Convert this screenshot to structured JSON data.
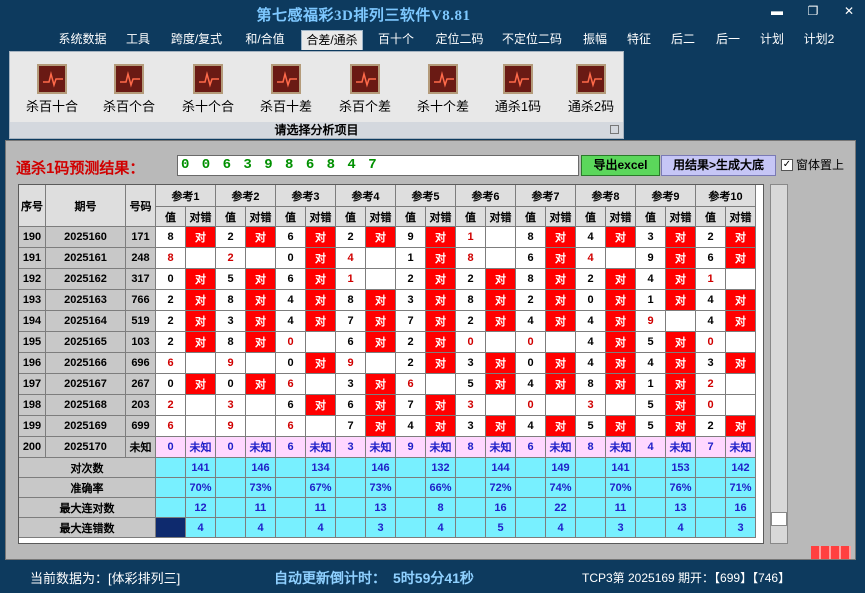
{
  "window": {
    "title": "第七感福彩3D排列三软件V8.81"
  },
  "menu": [
    "系统数据",
    "工具",
    "跨度/复式",
    "和/合值",
    "合差/通杀",
    "百十个",
    "定位二码",
    "不定位二码",
    "振幅",
    "特征",
    "后二",
    "后一",
    "计划",
    "计划2"
  ],
  "menu_active_index": 4,
  "ribbon": {
    "buttons": [
      "杀百十合",
      "杀百个合",
      "杀十个合",
      "杀百十差",
      "杀百个差",
      "杀十个差",
      "通杀1码",
      "通杀2码"
    ],
    "caption": "请选择分析项目"
  },
  "prediction": {
    "label": "通杀1码预测结果：",
    "value": "0 0 6 3 9 8 6 8 4 7",
    "excel_button": "导出excel",
    "generate_button": "用结果>生成大底",
    "on_top_label": "窗体置上",
    "on_top_checked": "✓"
  },
  "table": {
    "headers": {
      "seq": "序号",
      "issue": "期号",
      "code": "号码",
      "ref_groups": [
        "参考1",
        "参考2",
        "参考3",
        "参考4",
        "参考5",
        "参考6",
        "参考7",
        "参考8",
        "参考9",
        "参考10"
      ],
      "value": "值",
      "hit": "对错"
    },
    "rows": [
      {
        "seq": "190",
        "issue": "2025160",
        "code": "171",
        "refs": [
          [
            "8",
            "对"
          ],
          [
            "2",
            "对"
          ],
          [
            "6",
            "对"
          ],
          [
            "2",
            "对"
          ],
          [
            "9",
            "对"
          ],
          [
            "1",
            ""
          ],
          [
            "8",
            "对"
          ],
          [
            "4",
            "对"
          ],
          [
            "3",
            "对"
          ],
          [
            "2",
            "对"
          ]
        ]
      },
      {
        "seq": "191",
        "issue": "2025161",
        "code": "248",
        "refs": [
          [
            "8",
            ""
          ],
          [
            "2",
            ""
          ],
          [
            "0",
            "对"
          ],
          [
            "4",
            ""
          ],
          [
            "1",
            "对"
          ],
          [
            "8",
            ""
          ],
          [
            "6",
            "对"
          ],
          [
            "4",
            ""
          ],
          [
            "9",
            "对"
          ],
          [
            "6",
            "对"
          ]
        ]
      },
      {
        "seq": "192",
        "issue": "2025162",
        "code": "317",
        "refs": [
          [
            "0",
            "对"
          ],
          [
            "5",
            "对"
          ],
          [
            "6",
            "对"
          ],
          [
            "1",
            ""
          ],
          [
            "2",
            "对"
          ],
          [
            "2",
            "对"
          ],
          [
            "8",
            "对"
          ],
          [
            "2",
            "对"
          ],
          [
            "4",
            "对"
          ],
          [
            "1",
            ""
          ]
        ]
      },
      {
        "seq": "193",
        "issue": "2025163",
        "code": "766",
        "refs": [
          [
            "2",
            "对"
          ],
          [
            "8",
            "对"
          ],
          [
            "4",
            "对"
          ],
          [
            "8",
            "对"
          ],
          [
            "3",
            "对"
          ],
          [
            "8",
            "对"
          ],
          [
            "2",
            "对"
          ],
          [
            "0",
            "对"
          ],
          [
            "1",
            "对"
          ],
          [
            "4",
            "对"
          ]
        ]
      },
      {
        "seq": "194",
        "issue": "2025164",
        "code": "519",
        "refs": [
          [
            "2",
            "对"
          ],
          [
            "3",
            "对"
          ],
          [
            "4",
            "对"
          ],
          [
            "7",
            "对"
          ],
          [
            "7",
            "对"
          ],
          [
            "2",
            "对"
          ],
          [
            "4",
            "对"
          ],
          [
            "4",
            "对"
          ],
          [
            "9",
            ""
          ],
          [
            "4",
            "对"
          ]
        ]
      },
      {
        "seq": "195",
        "issue": "2025165",
        "code": "103",
        "refs": [
          [
            "2",
            "对"
          ],
          [
            "8",
            "对"
          ],
          [
            "0",
            ""
          ],
          [
            "6",
            "对"
          ],
          [
            "2",
            "对"
          ],
          [
            "0",
            ""
          ],
          [
            "0",
            ""
          ],
          [
            "4",
            "对"
          ],
          [
            "5",
            "对"
          ],
          [
            "0",
            ""
          ]
        ]
      },
      {
        "seq": "196",
        "issue": "2025166",
        "code": "696",
        "refs": [
          [
            "6",
            ""
          ],
          [
            "9",
            ""
          ],
          [
            "0",
            "对"
          ],
          [
            "9",
            ""
          ],
          [
            "2",
            "对"
          ],
          [
            "3",
            "对"
          ],
          [
            "0",
            "对"
          ],
          [
            "4",
            "对"
          ],
          [
            "4",
            "对"
          ],
          [
            "3",
            "对"
          ]
        ]
      },
      {
        "seq": "197",
        "issue": "2025167",
        "code": "267",
        "refs": [
          [
            "0",
            "对"
          ],
          [
            "0",
            "对"
          ],
          [
            "6",
            ""
          ],
          [
            "3",
            "对"
          ],
          [
            "6",
            ""
          ],
          [
            "5",
            "对"
          ],
          [
            "4",
            "对"
          ],
          [
            "8",
            "对"
          ],
          [
            "1",
            "对"
          ],
          [
            "2",
            ""
          ]
        ]
      },
      {
        "seq": "198",
        "issue": "2025168",
        "code": "203",
        "refs": [
          [
            "2",
            ""
          ],
          [
            "3",
            ""
          ],
          [
            "6",
            "对"
          ],
          [
            "6",
            "对"
          ],
          [
            "7",
            "对"
          ],
          [
            "3",
            ""
          ],
          [
            "0",
            ""
          ],
          [
            "3",
            ""
          ],
          [
            "5",
            "对"
          ],
          [
            "0",
            ""
          ]
        ]
      },
      {
        "seq": "199",
        "issue": "2025169",
        "code": "699",
        "refs": [
          [
            "6",
            ""
          ],
          [
            "9",
            ""
          ],
          [
            "6",
            ""
          ],
          [
            "7",
            "对"
          ],
          [
            "4",
            "对"
          ],
          [
            "3",
            "对"
          ],
          [
            "4",
            "对"
          ],
          [
            "5",
            "对"
          ],
          [
            "5",
            "对"
          ],
          [
            "2",
            "对"
          ]
        ]
      },
      {
        "seq": "200",
        "issue": "2025170",
        "code": "未知",
        "refs": [
          [
            "0",
            "未知"
          ],
          [
            "0",
            "未知"
          ],
          [
            "6",
            "未知"
          ],
          [
            "3",
            "未知"
          ],
          [
            "9",
            "未知"
          ],
          [
            "8",
            "未知"
          ],
          [
            "6",
            "未知"
          ],
          [
            "8",
            "未知"
          ],
          [
            "4",
            "未知"
          ],
          [
            "7",
            "未知"
          ]
        ]
      }
    ],
    "stats": [
      {
        "label": "对次数",
        "values": [
          "141",
          "146",
          "134",
          "146",
          "132",
          "144",
          "149",
          "141",
          "153",
          "142"
        ]
      },
      {
        "label": "准确率",
        "values": [
          "70%",
          "73%",
          "67%",
          "73%",
          "66%",
          "72%",
          "74%",
          "70%",
          "76%",
          "71%"
        ]
      },
      {
        "label": "最大连对数",
        "values": [
          "12",
          "11",
          "11",
          "13",
          "8",
          "16",
          "22",
          "11",
          "13",
          "16"
        ]
      },
      {
        "label": "最大连错数",
        "values": [
          "4",
          "4",
          "4",
          "3",
          "4",
          "5",
          "4",
          "3",
          "4",
          "3"
        ]
      }
    ]
  },
  "status": {
    "current_data": "当前数据为：[体彩排列三]",
    "countdown": "自动更新倒计时：　5时59分41秒",
    "latest": "TCP3第 2025169 期开：【699】【746】"
  },
  "colors": {
    "hit": "#ff0000",
    "unknown_row": "#ffd7ff",
    "stats": "#78f0ff",
    "title": "#7ec8ff"
  }
}
